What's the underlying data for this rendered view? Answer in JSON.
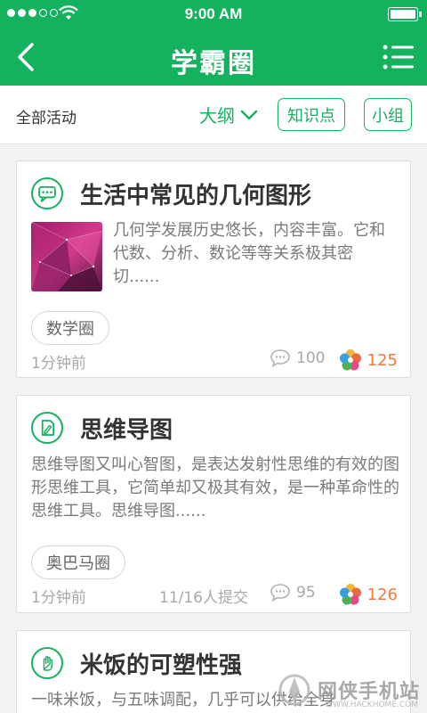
{
  "status_bar": {
    "time": "9:00 AM"
  },
  "nav": {
    "title": "学霸圈"
  },
  "filter": {
    "all_label": "全部活动",
    "outline_label": "大纲",
    "knowledge_label": "知识点",
    "group_label": "小组"
  },
  "posts": [
    {
      "title": "生活中常见的几何图形",
      "description": "几何学发展历史悠长，内容丰富。它和代数、分析、数论等等关系极其密切......",
      "tag": "数学圈",
      "time": "1分钟前",
      "comments": "100",
      "likes": "125",
      "icon": "chat-bubble-icon"
    },
    {
      "title": "思维导图",
      "description": "思维导图又叫心智图，是表达发射性思维的有效的图形思维工具，它简单却又极其有效，是一种革命性的思维工具。思维导图......",
      "tag": "奥巴马圈",
      "time": "1分钟前",
      "submitted": "11/16人提交",
      "comments": "95",
      "likes": "126",
      "icon": "pencil-doc-icon"
    },
    {
      "title": "米饭的可塑性强",
      "description": "一味米饭，与五味调配，几乎可以供给全身",
      "icon": "hand-icon"
    }
  ],
  "watermark": {
    "text": "网侠手机站",
    "sub": "WWW.HACKHOME.COM"
  },
  "colors": {
    "primary": "#14b15e",
    "likes": "#f07a3c"
  }
}
